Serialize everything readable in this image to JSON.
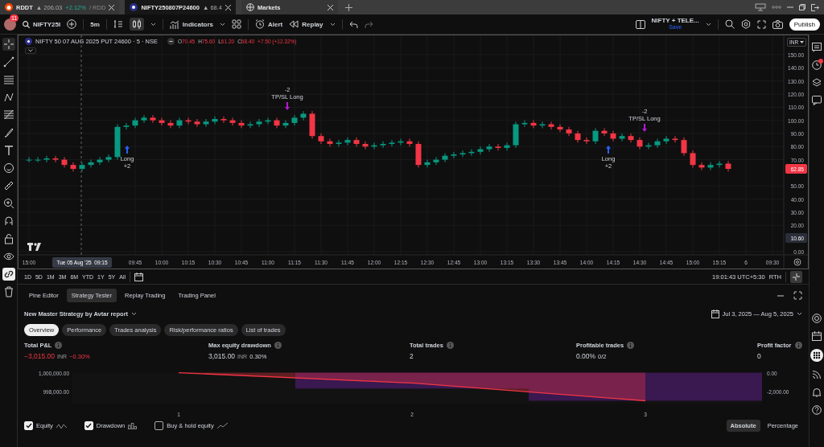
{
  "browser_tabs": [
    {
      "title": "RDDT",
      "price": "▲ 206.03",
      "change": "+2.12%",
      "extra": "/ RDD",
      "selected": false
    },
    {
      "title": "NIFTY250807P24600",
      "price": "▲ 68.4",
      "selected": true
    },
    {
      "title": "Markets",
      "selected": false
    }
  ],
  "toolbar": {
    "notifications": "11",
    "symbol": "NIFTY25I",
    "interval": "5m",
    "indicators": "Indicators",
    "alert": "Alert",
    "replay": "Replay",
    "layout_name": "NIFTY + TELE...",
    "layout_status": "Save",
    "publish": "Publish"
  },
  "chart": {
    "title": "NIFTY 50 07 AUG 2025 PUT 24600 · 5 · NSE",
    "ohlc": [
      {
        "label": "O",
        "value": "70.45"
      },
      {
        "label": "H",
        "value": "75.60"
      },
      {
        "label": "L",
        "value": "61.20"
      },
      {
        "label": "C",
        "value": "68.40"
      }
    ],
    "change": "+7.50 (+12.32%)",
    "currency": "INR",
    "last_price": "62.85",
    "marker_price": "10.60",
    "crosshair_time": "Tue 05 Aug '25  09:15",
    "trade_marks": [
      {
        "kind": "entry",
        "lines": [
          "Long",
          "+2"
        ]
      },
      {
        "kind": "exit",
        "lines": [
          "-2",
          "TP/SL Long"
        ]
      },
      {
        "kind": "entry",
        "lines": [
          "Long",
          "+2"
        ]
      },
      {
        "kind": "exit",
        "lines": [
          "-2",
          "TP/SL Long"
        ]
      }
    ],
    "chart_data": {
      "type": "candlestick",
      "categories": [
        "15:00",
        null,
        null,
        null,
        null,
        null,
        null,
        null,
        null,
        null,
        null,
        null,
        "09:45",
        null,
        null,
        "10:00",
        null,
        null,
        "10:15",
        null,
        null,
        "10:30",
        null,
        null,
        "10:45",
        null,
        null,
        "11:00",
        null,
        null,
        "11:15",
        null,
        null,
        "11:30",
        null,
        null,
        "11:45",
        null,
        null,
        "12:00",
        null,
        null,
        "12:15",
        null,
        null,
        "12:30",
        null,
        null,
        "12:45",
        null,
        null,
        "13:00",
        null,
        null,
        "13:15",
        null,
        null,
        "13:30",
        null,
        null,
        "13:45",
        null,
        null,
        "14:00",
        null,
        null,
        "14:15",
        null,
        null,
        "14:30",
        null,
        null,
        "14:45",
        null,
        null,
        "15:00",
        null,
        null,
        "15:15",
        null,
        null,
        "6",
        null,
        null,
        "09:30"
      ],
      "ohlc": [
        [
          70,
          72,
          68,
          70
        ],
        [
          70,
          72,
          68,
          70
        ],
        [
          70,
          73,
          68,
          71
        ],
        [
          71,
          73,
          68,
          70
        ],
        [
          70,
          72,
          64,
          66
        ],
        [
          66,
          68,
          61,
          63
        ],
        [
          63,
          68,
          61,
          66
        ],
        [
          66,
          70,
          64,
          68
        ],
        [
          68,
          72,
          66,
          70
        ],
        [
          70,
          74,
          68,
          72
        ],
        [
          72,
          97,
          70,
          95
        ],
        [
          95,
          98,
          93,
          96
        ],
        [
          96,
          102,
          94,
          100
        ],
        [
          100,
          104,
          98,
          102
        ],
        [
          102,
          104,
          98,
          100
        ],
        [
          100,
          102,
          96,
          98
        ],
        [
          98,
          100,
          94,
          96
        ],
        [
          96,
          102,
          94,
          100
        ],
        [
          100,
          102,
          97,
          99
        ],
        [
          99,
          101,
          95,
          97
        ],
        [
          97,
          101,
          95,
          99
        ],
        [
          99,
          103,
          97,
          101
        ],
        [
          101,
          103,
          98,
          100
        ],
        [
          100,
          102,
          96,
          98
        ],
        [
          98,
          100,
          94,
          96
        ],
        [
          96,
          99,
          94,
          97
        ],
        [
          97,
          101,
          95,
          99
        ],
        [
          99,
          102,
          97,
          100
        ],
        [
          100,
          102,
          94,
          96
        ],
        [
          96,
          100,
          94,
          98
        ],
        [
          98,
          104,
          96,
          102
        ],
        [
          102,
          107,
          100,
          105
        ],
        [
          105,
          107,
          86,
          88
        ],
        [
          88,
          90,
          82,
          84
        ],
        [
          84,
          86,
          80,
          82
        ],
        [
          82,
          85,
          80,
          83
        ],
        [
          83,
          87,
          81,
          85
        ],
        [
          85,
          87,
          80,
          82
        ],
        [
          82,
          84,
          78,
          80
        ],
        [
          80,
          83,
          78,
          81
        ],
        [
          81,
          84,
          79,
          82
        ],
        [
          82,
          85,
          80,
          83
        ],
        [
          83,
          86,
          81,
          84
        ],
        [
          84,
          86,
          80,
          82
        ],
        [
          82,
          84,
          64,
          66
        ],
        [
          66,
          70,
          64,
          68
        ],
        [
          68,
          72,
          66,
          70
        ],
        [
          70,
          75,
          68,
          73
        ],
        [
          73,
          76,
          71,
          74
        ],
        [
          74,
          77,
          72,
          75
        ],
        [
          75,
          78,
          73,
          76
        ],
        [
          76,
          80,
          74,
          78
        ],
        [
          78,
          82,
          76,
          80
        ],
        [
          80,
          82,
          77,
          79
        ],
        [
          79,
          83,
          77,
          81
        ],
        [
          81,
          99,
          79,
          97
        ],
        [
          97,
          100,
          95,
          98
        ],
        [
          98,
          100,
          94,
          96
        ],
        [
          96,
          99,
          94,
          97
        ],
        [
          97,
          99,
          93,
          95
        ],
        [
          95,
          97,
          91,
          93
        ],
        [
          93,
          95,
          88,
          90
        ],
        [
          90,
          92,
          83,
          85
        ],
        [
          85,
          87,
          82,
          84
        ],
        [
          84,
          94,
          82,
          92
        ],
        [
          92,
          94,
          88,
          90
        ],
        [
          90,
          92,
          84,
          86
        ],
        [
          86,
          90,
          84,
          88
        ],
        [
          88,
          90,
          83,
          85
        ],
        [
          85,
          87,
          78,
          80
        ],
        [
          80,
          83,
          78,
          81
        ],
        [
          81,
          86,
          79,
          84
        ],
        [
          84,
          88,
          82,
          86
        ],
        [
          86,
          88,
          83,
          85
        ],
        [
          85,
          87,
          73,
          75
        ],
        [
          75,
          77,
          64,
          66
        ],
        [
          66,
          68,
          62,
          64
        ],
        [
          64,
          68,
          62,
          66
        ],
        [
          66,
          69,
          64,
          67
        ],
        [
          67,
          69,
          61,
          63
        ],
        null,
        null,
        null,
        null,
        null
      ],
      "ylim": [
        -2.5,
        164.7
      ],
      "grid": true,
      "yticks": [
        {
          "value": 150,
          "label": "150.00"
        },
        {
          "value": 140,
          "label": "140.00"
        },
        {
          "value": 130,
          "label": "130.00"
        },
        {
          "value": 120,
          "label": "120.00"
        },
        {
          "value": 110,
          "label": "110.00"
        },
        {
          "value": 100,
          "label": "100.00"
        },
        {
          "value": 90,
          "label": "90.00"
        },
        {
          "value": 80,
          "label": "80.00"
        },
        {
          "value": 70,
          "label": "70.00"
        },
        {
          "value": 50,
          "label": "50.00"
        },
        {
          "value": 40,
          "label": "40.00"
        },
        {
          "value": 30,
          "label": "30.00"
        },
        {
          "value": 20,
          "label": "20.00"
        },
        {
          "value": 0,
          "label": "0.00"
        }
      ]
    }
  },
  "ranges": [
    "1D",
    "5D",
    "1M",
    "3M",
    "6M",
    "YTD",
    "1Y",
    "5Y",
    "All"
  ],
  "clock": "19:01:43 UTC+5:30",
  "session": "RTH",
  "panel_tabs": [
    {
      "label": "Pine Editor",
      "selected": false
    },
    {
      "label": "Strategy Tester",
      "selected": true
    },
    {
      "label": "Replay Trading",
      "selected": false
    },
    {
      "label": "Trading Panel",
      "selected": false
    }
  ],
  "strategy": {
    "name": "New Master Strategy by Avtar report",
    "date_range": "Jul 3, 2025 — Aug 5, 2025",
    "subtabs": [
      {
        "label": "Overview",
        "selected": true
      },
      {
        "label": "Performance",
        "selected": false
      },
      {
        "label": "Trades analysis",
        "selected": false
      },
      {
        "label": "Risk/performance ratios",
        "selected": false
      },
      {
        "label": "List of trades",
        "selected": false
      }
    ],
    "metrics": [
      {
        "label": "Total P&L",
        "value": "−3,015.00",
        "unit": "INR",
        "extra": "−0.30%",
        "negative": true
      },
      {
        "label": "Max equity drawdown",
        "value": "3,015.00",
        "unit": "INR",
        "extra": "0.30%",
        "negative": false
      },
      {
        "label": "Total trades",
        "value": "2",
        "negative": false
      },
      {
        "label": "Profitable trades",
        "value": "0.00%",
        "extra": "0/2",
        "negative": false
      },
      {
        "label": "Profit factor",
        "value": "0",
        "negative": false
      }
    ],
    "chart_data": {
      "type": "line",
      "x": [
        "1",
        "2",
        "3"
      ],
      "series": [
        {
          "name": "Equity",
          "color": "#f23645",
          "values": [
            1000000,
            998900,
            997000
          ]
        },
        {
          "name": "Drawdown",
          "type": "bar",
          "axis": "y2",
          "color": "#3a1850",
          "values": [
            null,
            -1700,
            -3000
          ]
        }
      ],
      "ylim": [
        996700,
        1000000
      ],
      "y2lim": [
        -3300,
        0
      ],
      "yticks": [
        {
          "value": 1000000,
          "label": "1,000,000.00"
        },
        {
          "value": 998000,
          "label": "998,000.00"
        }
      ],
      "y2ticks": [
        {
          "value": 0,
          "label": "0.00"
        },
        {
          "value": -2000,
          "label": "-2,000.00"
        }
      ]
    },
    "legend": [
      {
        "checked": true
      },
      {
        "checked": true
      },
      {
        "label": "Buy & hold equity",
        "checked": false
      }
    ],
    "modes": [
      {
        "label": "Absolute",
        "selected": true
      },
      {
        "label": "Percentage",
        "selected": false
      }
    ]
  }
}
